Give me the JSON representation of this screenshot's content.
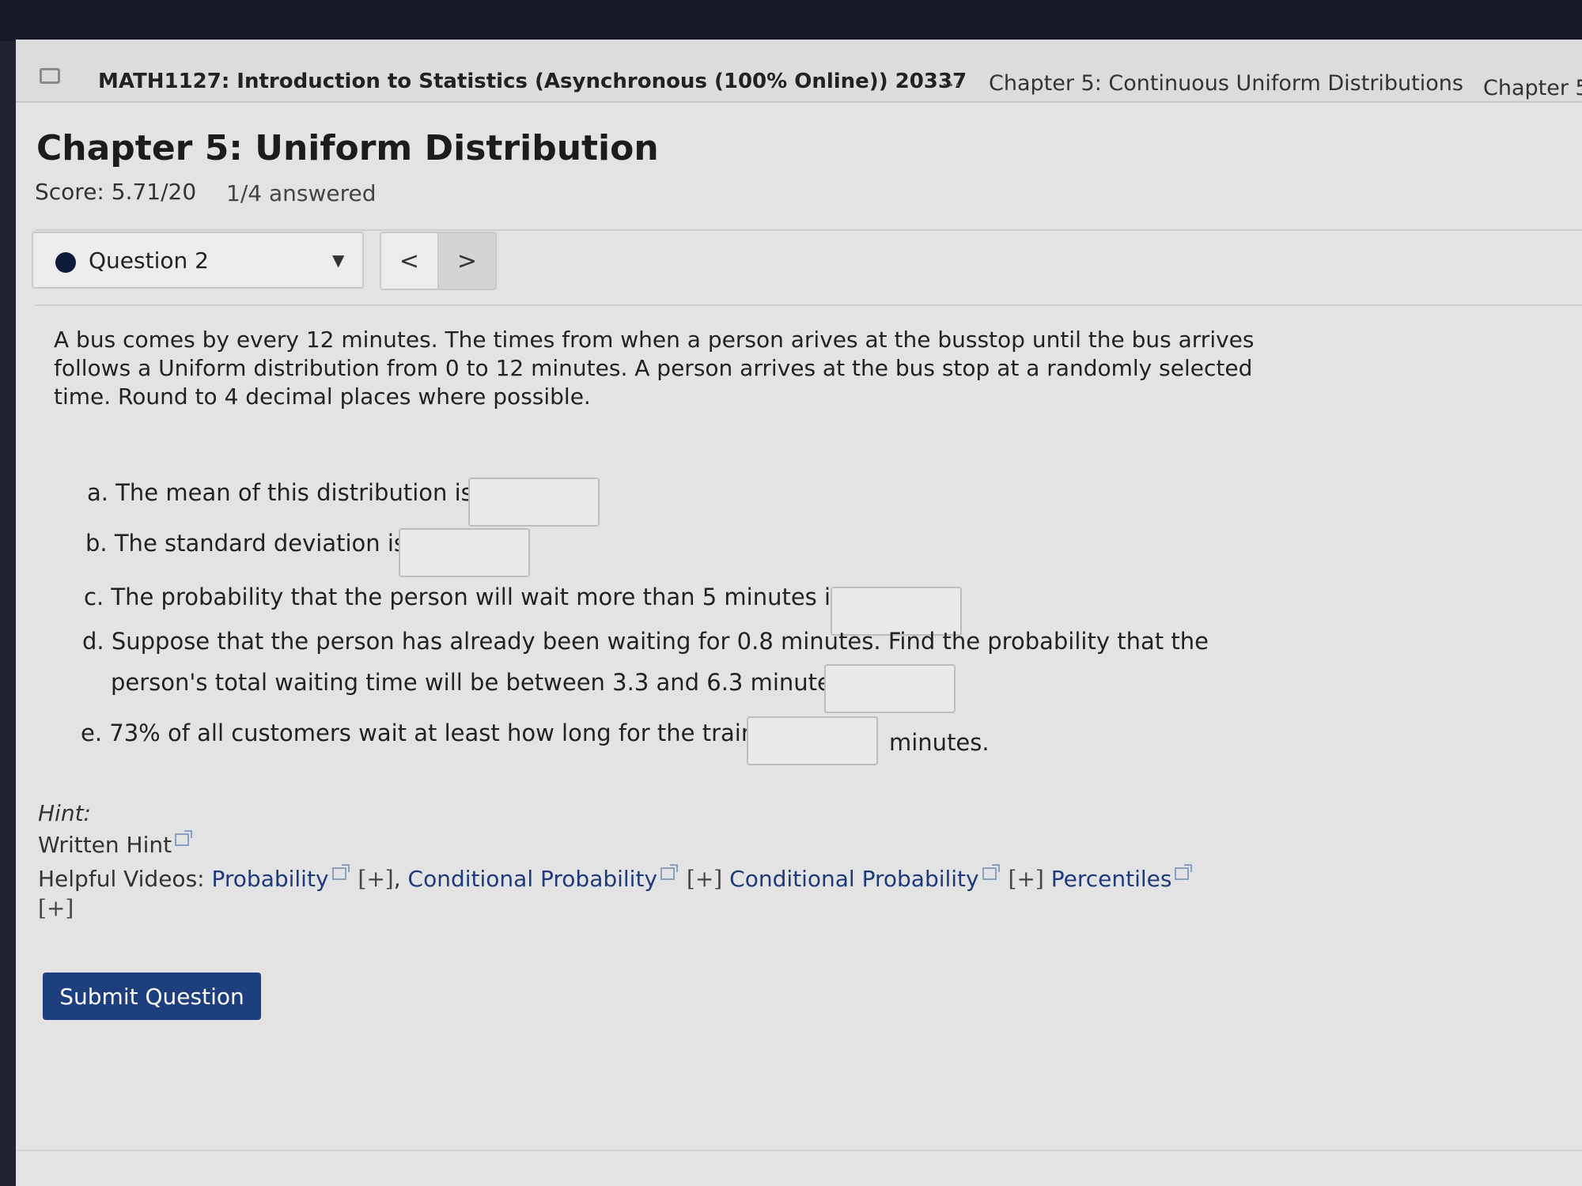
{
  "nav": {
    "course_title": "MATH1127: Introduction to Statistics (Asynchronous (100% Online)) 20337",
    "ellipsis": "...",
    "breadcrumb_1": "Chapter 5: Continuous Uniform Distributions",
    "breadcrumb_2": "Chapter 5"
  },
  "page": {
    "title": "Chapter 5: Uniform Distribution",
    "score": "Score: 5.71/20",
    "answered": "1/4 answered"
  },
  "question_selector": {
    "label": "Question 2",
    "caret": "▼",
    "prev": "<",
    "next": ">"
  },
  "problem": {
    "text": "A bus comes by every 12 minutes. The times from when a person arives at the busstop until the bus arrives follows a Uniform distribution from 0 to 12 minutes. A person arrives at the bus stop at a randomly selected time. Round to 4 decimal places where possible.",
    "part_a": "a. The mean of this distribution is",
    "part_b": "b. The standard deviation is",
    "part_c": "c. The probability that the person will wait more than 5 minutes is",
    "part_d_line1": "d. Suppose that the person has already been waiting for 0.8 minutes. Find the probability that the",
    "part_d_line2": "person's total waiting time will be between 3.3 and 6.3 minutes",
    "part_e": "e. 73% of all customers wait at least how long for the train?",
    "part_e_suffix": "minutes.",
    "answers": {
      "a": "",
      "b": "",
      "c": "",
      "d": "",
      "e": ""
    }
  },
  "hint": {
    "heading": "Hint:",
    "written_hint": "Written Hint",
    "videos_label": "Helpful Videos:",
    "video_1": "Probability",
    "plus": "[+]",
    "comma": ",",
    "video_2": "Conditional Probability",
    "video_3": "Conditional Probability",
    "video_4": "Percentiles"
  },
  "actions": {
    "submit": "Submit Question"
  }
}
